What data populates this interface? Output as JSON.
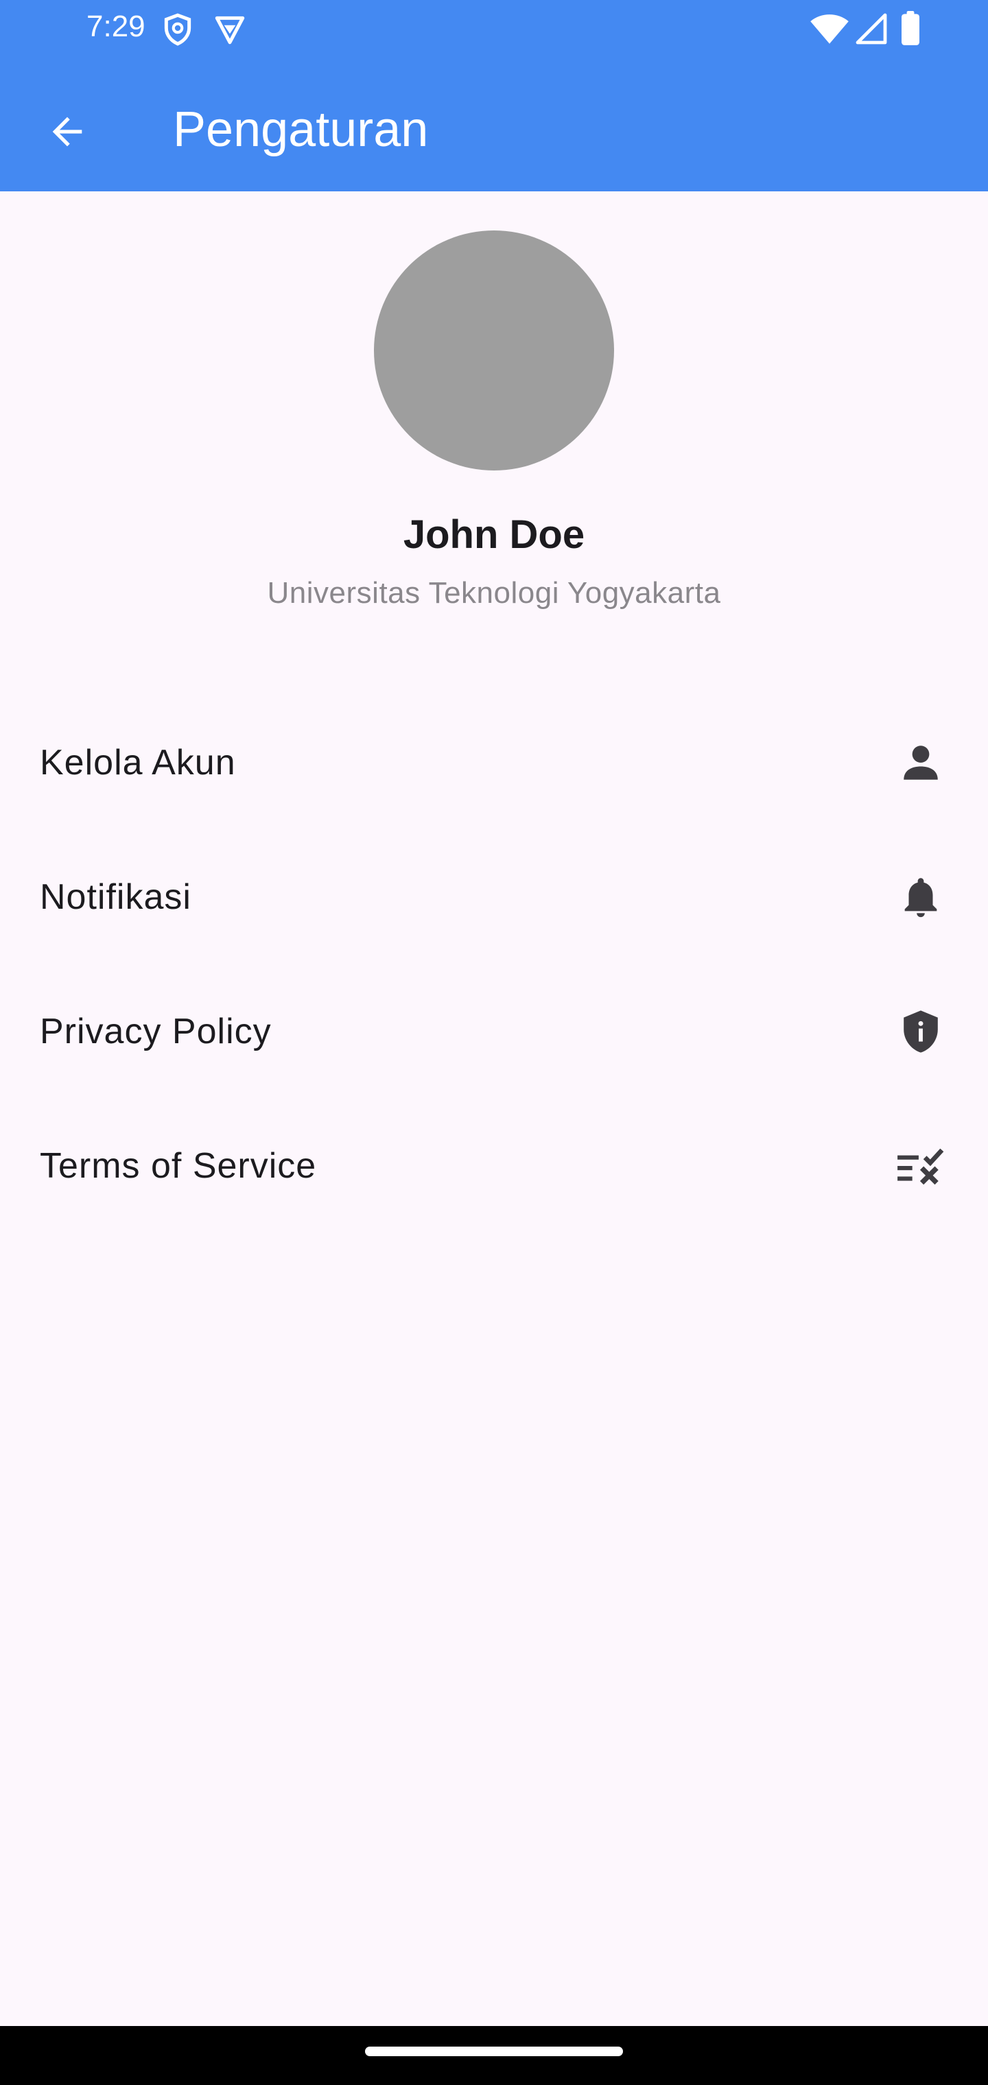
{
  "status_bar": {
    "time": "7:29",
    "icons": [
      "shield-icon",
      "vpn-icon",
      "wifi-icon",
      "signal-icon",
      "battery-icon"
    ]
  },
  "app_bar": {
    "title": "Pengaturan",
    "back_icon": "arrow-back-icon",
    "color": "#4489f2"
  },
  "profile": {
    "name": "John Doe",
    "organization": "Universitas Teknologi Yogyakarta",
    "avatar_color": "#9e9e9e"
  },
  "menu": {
    "items": [
      {
        "label": "Kelola Akun",
        "icon": "person-icon"
      },
      {
        "label": "Notifikasi",
        "icon": "bell-icon"
      },
      {
        "label": "Privacy Policy",
        "icon": "shield-info-icon"
      },
      {
        "label": "Terms of Service",
        "icon": "playlist-remove-icon"
      }
    ]
  }
}
